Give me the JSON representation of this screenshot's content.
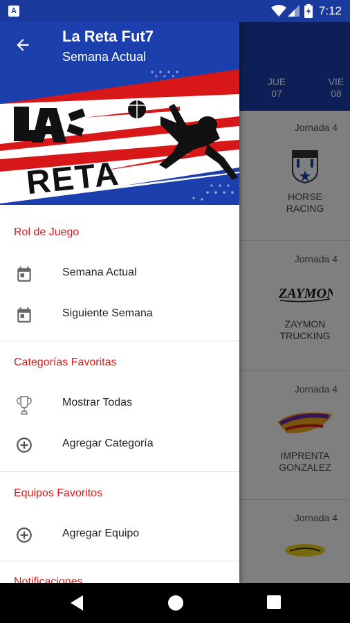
{
  "status_bar": {
    "time": "7:12",
    "app_icon_letter": "A",
    "icons": [
      "wifi-icon",
      "signal-icon",
      "battery-icon"
    ]
  },
  "app": {
    "days": [
      {
        "name": "JUE",
        "num": "07"
      },
      {
        "name": "VIE",
        "num": "08"
      }
    ],
    "matches": [
      {
        "jornada": "Jornada 4",
        "team_line1": "HORSE",
        "team_line2": "RACING"
      },
      {
        "jornada": "Jornada 4",
        "team_line1": "ZAYMON",
        "team_line2": "TRUCKING"
      },
      {
        "jornada": "Jornada 4",
        "team_line1": "IMPRENTA",
        "team_line2": "GONZALEZ"
      },
      {
        "jornada": "Jornada 4",
        "team_line1": "",
        "team_line2": ""
      }
    ]
  },
  "drawer": {
    "title": "La Reta Fut7",
    "subtitle": "Semana Actual",
    "banner_logo_text": "LA RETA",
    "sections": [
      {
        "title": "Rol de Juego",
        "items": [
          {
            "label": "Semana Actual",
            "icon": "calendar-icon"
          },
          {
            "label": "Siguiente Semana",
            "icon": "calendar-icon"
          }
        ]
      },
      {
        "title": "Categorías Favoritas",
        "items": [
          {
            "label": "Mostrar Todas",
            "icon": "trophy-icon"
          },
          {
            "label": "Agregar Categoría",
            "icon": "add-circle-icon"
          }
        ]
      },
      {
        "title": "Equipos Favoritos",
        "items": [
          {
            "label": "Agregar Equipo",
            "icon": "add-circle-icon"
          }
        ]
      },
      {
        "title": "Notificaciones",
        "items": []
      }
    ]
  },
  "colors": {
    "primary": "#1c3fae",
    "accent": "#d81b1b"
  }
}
